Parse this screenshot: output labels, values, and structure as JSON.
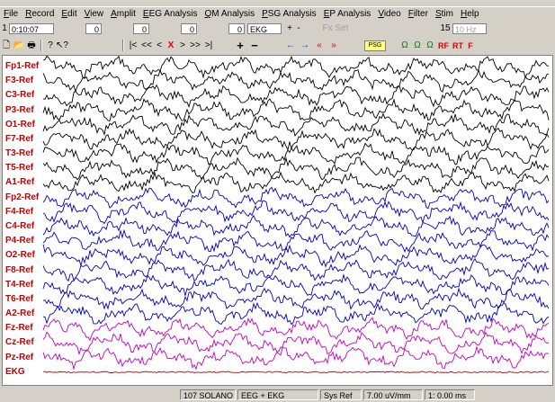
{
  "menu": [
    "File",
    "Record",
    "Edit",
    "View",
    "Amplit",
    "EEG Analysis",
    "QM Analysis",
    "PSG Analysis",
    "EP Analysis",
    "Video",
    "Filter",
    "Stim",
    "Help"
  ],
  "toolbar1": {
    "index": "1",
    "time": "0:10:07",
    "field1": "0",
    "field2": "0",
    "field3": "0",
    "field4": "0",
    "channel_select": "EKG",
    "plus": "+",
    "minus": "-",
    "fx_label": "Fx Set",
    "speed_num": "15",
    "freq": "10 Hz"
  },
  "toolbar2": {
    "nav": [
      "|<",
      "<<",
      "<",
      "X",
      ">",
      ">>",
      ">|"
    ],
    "plus": "+",
    "minus": "−",
    "psg": "PSG",
    "flags": [
      "RF",
      "RT",
      "F"
    ]
  },
  "channels": [
    {
      "label": "Fp1-Ref",
      "color": "#000000"
    },
    {
      "label": "F3-Ref",
      "color": "#000000"
    },
    {
      "label": "C3-Ref",
      "color": "#000000"
    },
    {
      "label": "P3-Ref",
      "color": "#000000"
    },
    {
      "label": "O1-Ref",
      "color": "#000000"
    },
    {
      "label": "F7-Ref",
      "color": "#000000"
    },
    {
      "label": "T3-Ref",
      "color": "#000000"
    },
    {
      "label": "T5-Ref",
      "color": "#000000"
    },
    {
      "label": "A1-Ref",
      "color": "#000000"
    },
    {
      "label": "Fp2-Ref",
      "color": "#0000c0"
    },
    {
      "label": "F4-Ref",
      "color": "#0000c0"
    },
    {
      "label": "C4-Ref",
      "color": "#0000c0"
    },
    {
      "label": "P4-Ref",
      "color": "#0000c0"
    },
    {
      "label": "O2-Ref",
      "color": "#0000c0"
    },
    {
      "label": "F8-Ref",
      "color": "#0000c0"
    },
    {
      "label": "T4-Ref",
      "color": "#0000c0"
    },
    {
      "label": "T6-Ref",
      "color": "#0000c0"
    },
    {
      "label": "A2-Ref",
      "color": "#0000c0"
    },
    {
      "label": "Fz-Ref",
      "color": "#c000c0"
    },
    {
      "label": "Cz-Ref",
      "color": "#c000c0"
    },
    {
      "label": "Pz-Ref",
      "color": "#c000c0"
    },
    {
      "label": "EKG",
      "color": "#c00000"
    }
  ],
  "status": {
    "s1": "107  SOLANO",
    "s2": "EEG + EKG",
    "s3": "Sys Ref",
    "s4": "7.00  uV/mm",
    "s5": "1:  0.00 ms"
  }
}
